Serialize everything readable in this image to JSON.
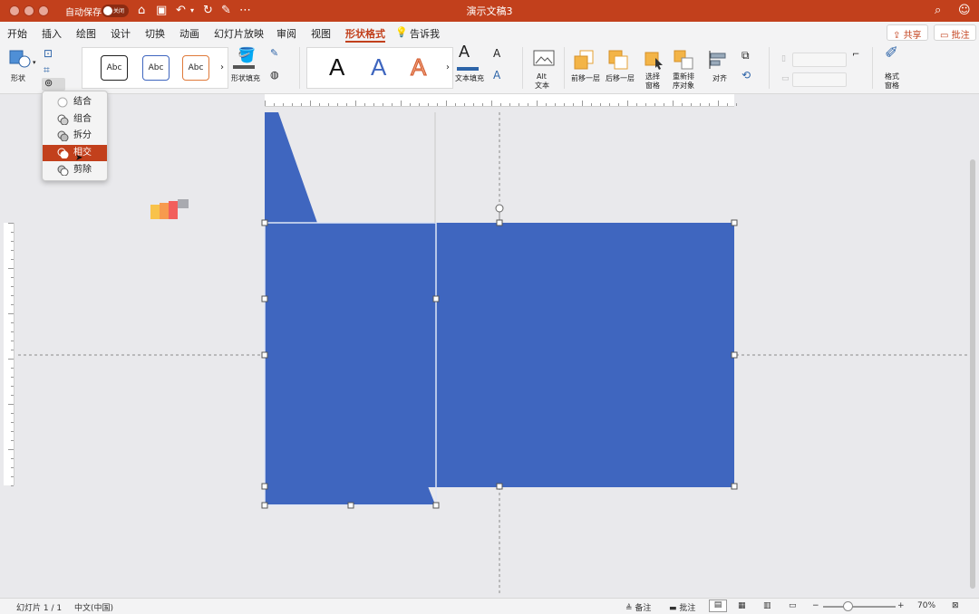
{
  "window": {
    "title": "演示文稿3",
    "autosave_label": "自动保存",
    "autosave_state": "关闭"
  },
  "tabs": [
    "开始",
    "插入",
    "绘图",
    "设计",
    "切换",
    "动画",
    "幻灯片放映",
    "审阅",
    "视图",
    "形状格式"
  ],
  "active_tab": "形状格式",
  "tell_me": "告诉我",
  "share_label": "共享",
  "comments_label": "批注",
  "ribbon": {
    "shape_label": "形状",
    "abc": "Abc",
    "wordart": "A",
    "shape_fill": "形状填充",
    "text_fill": "文本填充",
    "alt_text_1": "Alt",
    "alt_text_2": "文本",
    "bring_forward": "前移一层",
    "send_backward": "后移一层",
    "selection_pane_1": "选择",
    "selection_pane_2": "窗格",
    "reorder_1": "重新排",
    "reorder_2": "序对象",
    "align": "对齐",
    "format_pane_1": "格式",
    "format_pane_2": "窗格"
  },
  "merge_menu": {
    "items": [
      "结合",
      "组合",
      "拆分",
      "相交",
      "剪除"
    ],
    "selected": "相交"
  },
  "colors": {
    "accent": "#c2401c",
    "shape_blue": "#3f66bf"
  },
  "statusbar": {
    "slide": "幻灯片 1 / 1",
    "language": "中文(中国)",
    "notes": "备注",
    "comments": "批注",
    "zoom": "70%"
  }
}
